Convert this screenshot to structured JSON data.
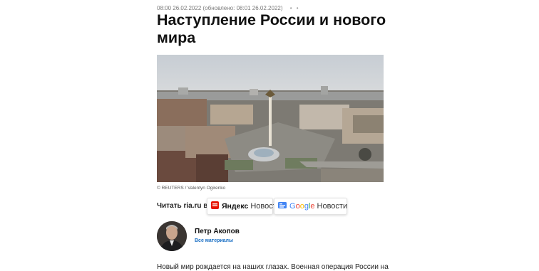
{
  "article": {
    "meta": "08:00 26.02.2022 (обновлено: 08:01 26.02.2022)",
    "title": "Наступление России и нового мира",
    "photo_credit": "© REUTERS / Valentyn Ogirenko",
    "lead": "Новый мир рождается на наших глазах. Военная операция России на"
  },
  "read_in": {
    "label": "Читать ria.ru в",
    "yandex": {
      "brand": "Яндекс",
      "label": "Новости"
    },
    "google": {
      "brand": "Google",
      "label": "Новости"
    }
  },
  "author": {
    "name": "Петр Акопов",
    "all_materials": "Все материалы"
  },
  "icons": [
    "more-dots-icon",
    "yandex-news-icon",
    "google-news-icon"
  ]
}
